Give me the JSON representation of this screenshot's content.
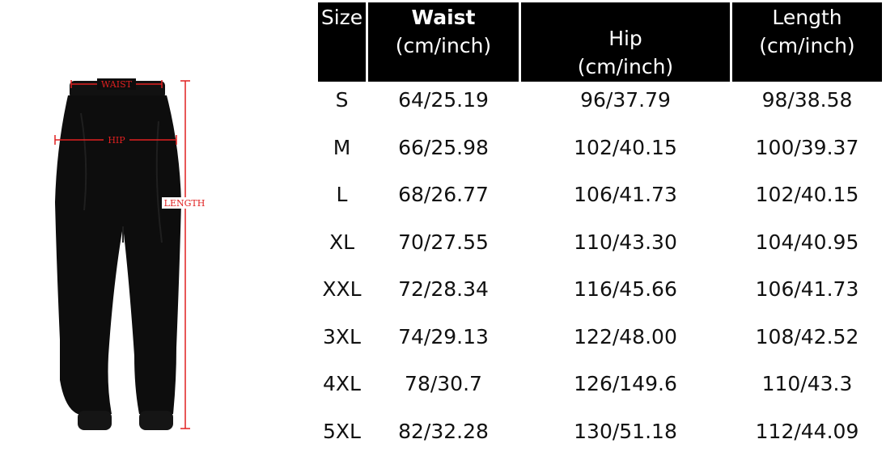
{
  "diagram": {
    "labels": {
      "waist": "WAIST",
      "hip": "HIP",
      "length": "LENGTH"
    }
  },
  "table": {
    "headers": [
      {
        "name": "Size",
        "unit": ""
      },
      {
        "name": "Waist",
        "unit": "(cm/inch)"
      },
      {
        "name": "Hip",
        "unit": "(cm/inch)"
      },
      {
        "name": "Length",
        "unit": "(cm/inch)"
      }
    ],
    "rows": [
      [
        "S",
        "64/25.19",
        "96/37.79",
        "98/38.58"
      ],
      [
        "M",
        "66/25.98",
        "102/40.15",
        "100/39.37"
      ],
      [
        "L",
        "68/26.77",
        "106/41.73",
        "102/40.15"
      ],
      [
        "XL",
        "70/27.55",
        "110/43.30",
        "104/40.95"
      ],
      [
        "XXL",
        "72/28.34",
        "116/45.66",
        "106/41.73"
      ],
      [
        "3XL",
        "74/29.13",
        "122/48.00",
        "108/42.52"
      ],
      [
        "4XL",
        "78/30.7",
        "126/149.6",
        "110/43.3"
      ],
      [
        "5XL",
        "82/32.28",
        "130/51.18",
        "112/44.09"
      ]
    ]
  }
}
